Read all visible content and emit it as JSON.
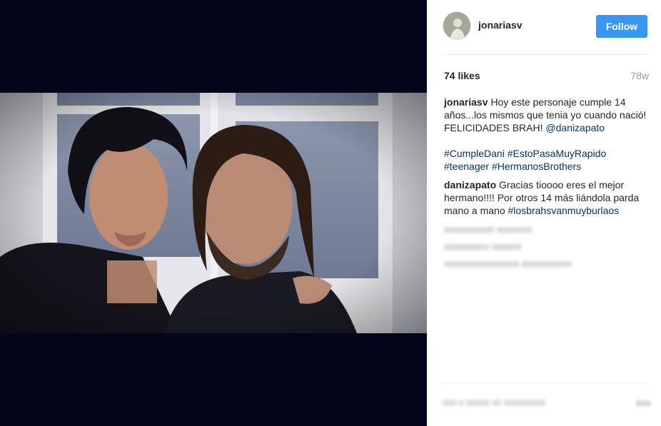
{
  "post": {
    "username": "jonariasv",
    "follow_label": "Follow",
    "likes": "74 likes",
    "age": "78w",
    "caption": {
      "author": "jonariasv",
      "text": "Hoy este personaje cumple 14 años...los mismos que tenia yo cuando nació! FELICIDADES BRAH!",
      "mention": "@danizapato",
      "hashtags_line1": "#CumpleDani #EstoPasaMuyRapido",
      "hashtags_line2": "#teenager #HermanosBrothers"
    },
    "reply": {
      "author": "danizapato",
      "text": "Gracias tioooo eres el mejor hermano!!!! Por otros 14 más liándola parda mano a mano",
      "hashtag": "#losbrahsvanmuyburlaos"
    },
    "blurred": {
      "line1": "xxxxxxxxxx xxxxxxx",
      "line2": "xxxxxxxxx xxxxxx",
      "line3": "xxxxxxxxxxxxxxx xxxxxxxxxx",
      "footer": "xxx x xxxxx xx xxxxxxxxx",
      "footer_icon": "xxx"
    }
  },
  "colors": {
    "accent": "#3897f0",
    "link": "#003569",
    "media_bg": "#04051b"
  },
  "icons": {
    "avatar": "user-avatar"
  }
}
